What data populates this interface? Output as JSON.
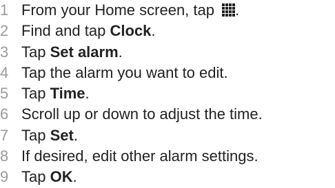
{
  "steps": [
    {
      "number": "1",
      "prefix": "From your Home screen, tap ",
      "bold": "",
      "suffix": ".",
      "icon": "apps-grid-icon"
    },
    {
      "number": "2",
      "prefix": "Find and tap ",
      "bold": "Clock",
      "suffix": "."
    },
    {
      "number": "3",
      "prefix": "Tap ",
      "bold": "Set alarm",
      "suffix": "."
    },
    {
      "number": "4",
      "prefix": "Tap the alarm you want to edit.",
      "bold": "",
      "suffix": ""
    },
    {
      "number": "5",
      "prefix": "Tap ",
      "bold": "Time",
      "suffix": "."
    },
    {
      "number": "6",
      "prefix": "Scroll up or down to adjust the time.",
      "bold": "",
      "suffix": ""
    },
    {
      "number": "7",
      "prefix": "Tap ",
      "bold": "Set",
      "suffix": "."
    },
    {
      "number": "8",
      "prefix": "If desired, edit other alarm settings.",
      "bold": "",
      "suffix": ""
    },
    {
      "number": "9",
      "prefix": "Tap ",
      "bold": "OK",
      "suffix": "."
    }
  ]
}
